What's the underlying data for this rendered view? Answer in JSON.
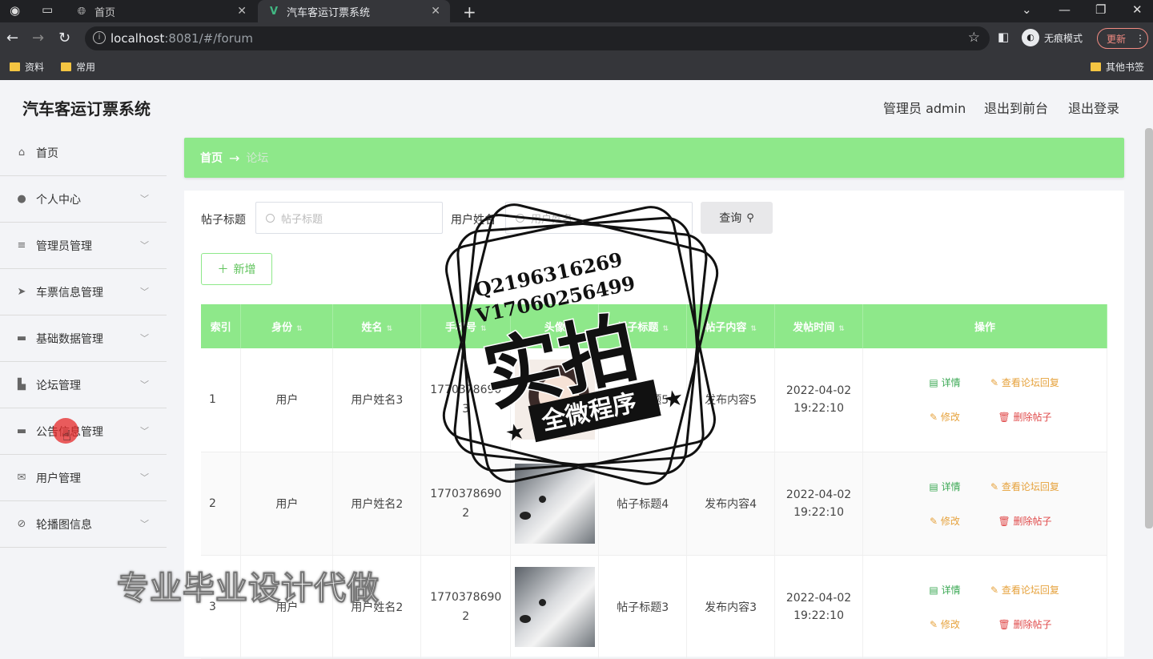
{
  "browser": {
    "tabs": [
      {
        "label": "首页"
      },
      {
        "label": "汽车客运订票系统"
      }
    ],
    "url_host": "localhost",
    "url_rest": ":8081/#/forum",
    "incognito_label": "无痕模式",
    "update_label": "更新",
    "bookmarks": [
      "资料",
      "常用"
    ],
    "other_bookmarks": "其他书签"
  },
  "app": {
    "brand": "汽车客运订票系统",
    "header_links": [
      "管理员 admin",
      "退出到前台",
      "退出登录"
    ]
  },
  "sidebar": {
    "items": [
      {
        "label": "首页",
        "icon": "home-icon"
      },
      {
        "label": "个人中心",
        "icon": "user-icon"
      },
      {
        "label": "管理员管理",
        "icon": "menu-icon"
      },
      {
        "label": "车票信息管理",
        "icon": "send-icon"
      },
      {
        "label": "基础数据管理",
        "icon": "monitor-icon"
      },
      {
        "label": "论坛管理",
        "icon": "forum-icon"
      },
      {
        "label": "公告信息管理",
        "icon": "monitor-icon"
      },
      {
        "label": "用户管理",
        "icon": "mail-icon"
      },
      {
        "label": "轮播图信息",
        "icon": "compass-icon"
      }
    ]
  },
  "breadcrumb": {
    "home": "首页",
    "current": "论坛"
  },
  "search": {
    "title_label": "帖子标题",
    "title_placeholder": "帖子标题",
    "user_label": "用户姓名",
    "user_placeholder": "用户姓名",
    "query_label": "查询",
    "add_label": "新增"
  },
  "table": {
    "headers": [
      "索引",
      "身份",
      "姓名",
      "手机号",
      "头像",
      "帖子标题",
      "帖子内容",
      "发帖时间",
      "操作"
    ],
    "rows": [
      {
        "index": "1",
        "role": "用户",
        "name": "用户姓名3",
        "phone": "17703786903",
        "title": "帖子标题5",
        "content": "发布内容5",
        "time_date": "2022-04-02",
        "time_clock": "19:22:10"
      },
      {
        "index": "2",
        "role": "用户",
        "name": "用户姓名2",
        "phone": "17703786902",
        "title": "帖子标题4",
        "content": "发布内容4",
        "time_date": "2022-04-02",
        "time_clock": "19:22:10"
      },
      {
        "index": "3",
        "role": "用户",
        "name": "用户姓名2",
        "phone": "17703786902",
        "title": "帖子标题3",
        "content": "发布内容3",
        "time_date": "2022-04-02",
        "time_clock": "19:22:10"
      }
    ],
    "actions": {
      "detail": "详情",
      "replies": "查看论坛回复",
      "edit": "修改",
      "delete": "删除帖子"
    }
  },
  "overlay": {
    "stamp_line1": "Q2196316269",
    "stamp_line2": "V17060256499",
    "stamp_big": "实拍",
    "stamp_banner": "全微程序",
    "watermark": "专业毕业设计代做"
  },
  "colors": {
    "accent": "#8ee88a",
    "warning": "#e6a23c",
    "danger": "#e04b4b",
    "success": "#3aa853"
  }
}
